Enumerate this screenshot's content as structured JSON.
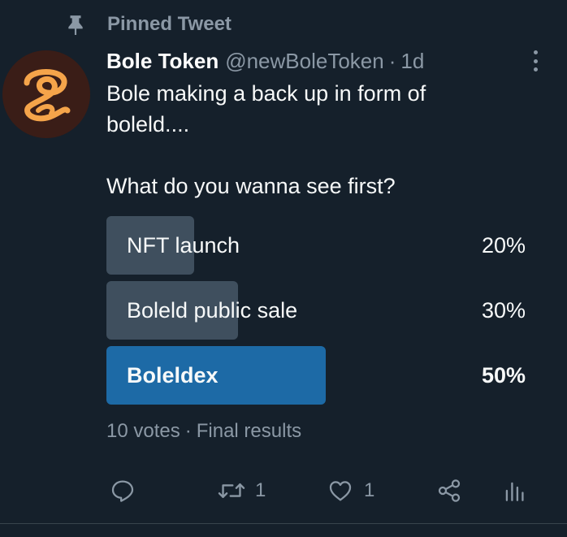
{
  "pinned": {
    "label": "Pinned Tweet"
  },
  "tweet": {
    "display_name": "Bole Token",
    "handle": "@newBoleToken",
    "separator": "·",
    "time": "1d",
    "text_line1": "Bole making a back up in form of",
    "text_line2": "boleld....",
    "text_line3": "What do you wanna see first?"
  },
  "poll": {
    "options": [
      {
        "label": "NFT launch",
        "percent_text": "20%",
        "percent": 20,
        "winner": false
      },
      {
        "label": "Boleld public sale",
        "percent_text": "30%",
        "percent": 30,
        "winner": false
      },
      {
        "label": "Boleldex",
        "percent_text": "50%",
        "percent": 50,
        "winner": true
      }
    ],
    "votes": "10 votes",
    "dot": "·",
    "status": "Final results"
  },
  "actions": {
    "retweet_count": "1",
    "like_count": "1"
  },
  "colors": {
    "background": "#15202b",
    "secondary_text": "#8b98a5",
    "bar_default": "#3f4f5e",
    "bar_winner": "#1d6aa6",
    "avatar_accent": "#f5a44a"
  },
  "icons": [
    "pin-icon",
    "more-icon",
    "reply-icon",
    "retweet-icon",
    "like-icon",
    "share-icon",
    "analytics-icon"
  ]
}
